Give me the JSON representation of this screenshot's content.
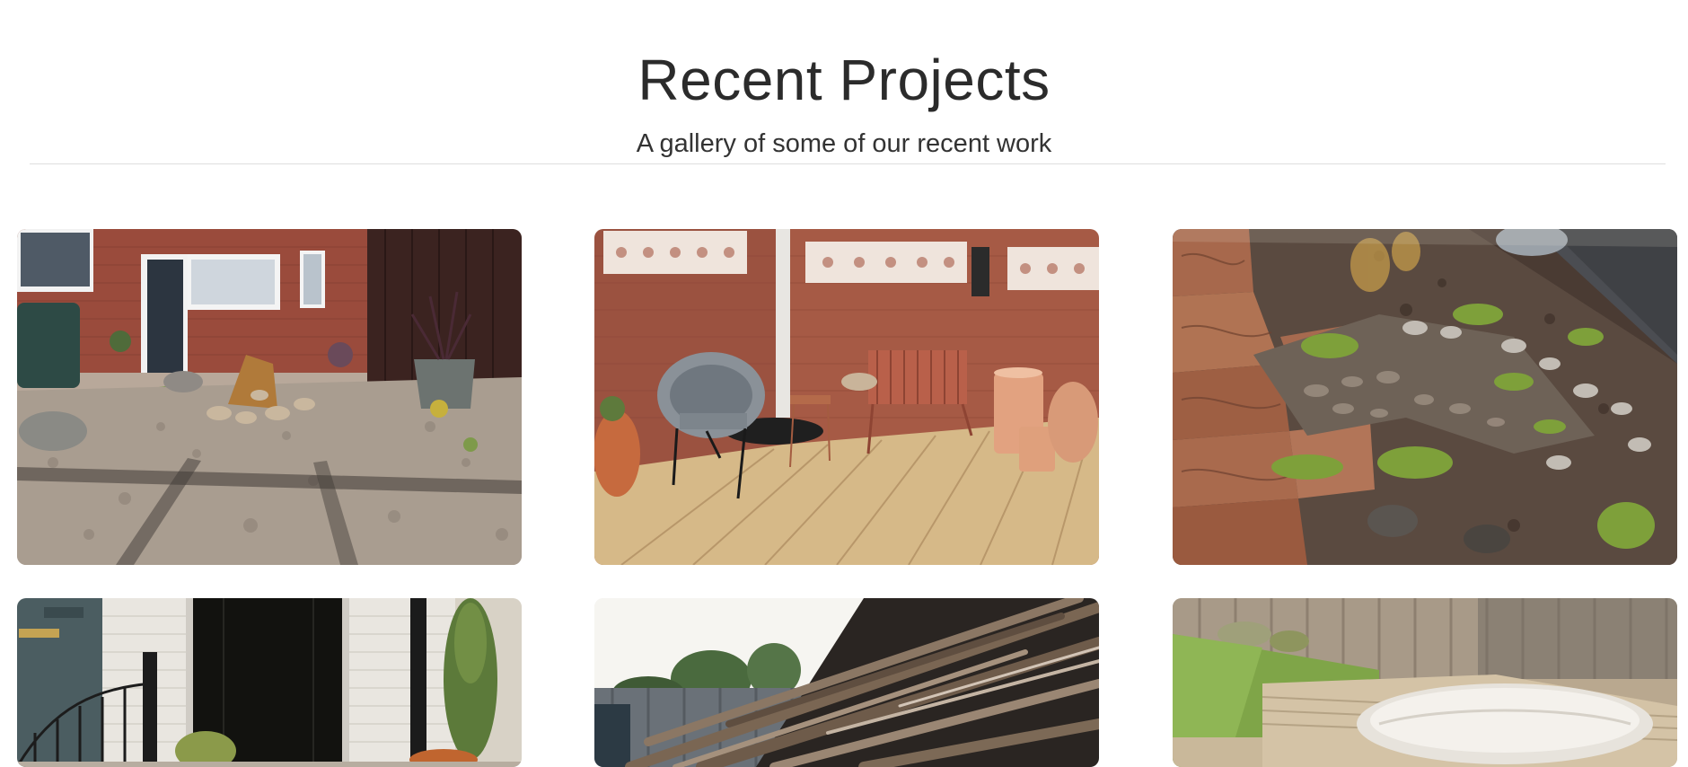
{
  "section": {
    "title": "Recent Projects",
    "subtitle": "A gallery of some of our recent work"
  },
  "gallery": {
    "items": [
      {
        "icon": "gravel-garden-photo"
      },
      {
        "icon": "decking-patio-photo"
      },
      {
        "icon": "water-feature-photo"
      },
      {
        "icon": "front-door-garden-photo"
      },
      {
        "icon": "rustic-fence-photo"
      },
      {
        "icon": "hot-tub-decking-photo"
      }
    ]
  },
  "colors": {
    "background": "#ffffff",
    "title": "#2b2b2b",
    "divider": "#dedede"
  }
}
